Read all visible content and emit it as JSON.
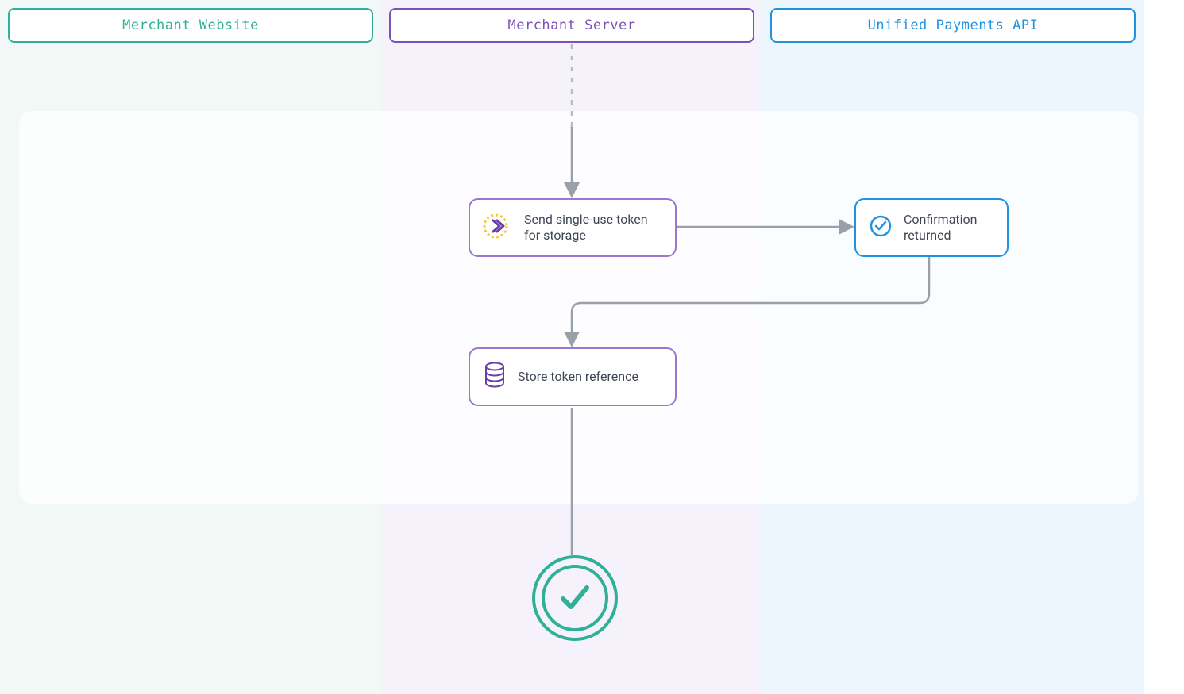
{
  "lanes": {
    "merchant_website": "Merchant Website",
    "merchant_server": "Merchant Server",
    "payments_api": "Unified Payments API"
  },
  "nodes": {
    "send_token": "Send single-use token for storage",
    "confirmation": "Confirmation returned",
    "store_ref": "Store token reference"
  },
  "colors": {
    "merchant_website": "#2fb097",
    "merchant_server": "#7c50b9",
    "payments_api": "#1f93e0",
    "connector": "#9aa0a8"
  }
}
